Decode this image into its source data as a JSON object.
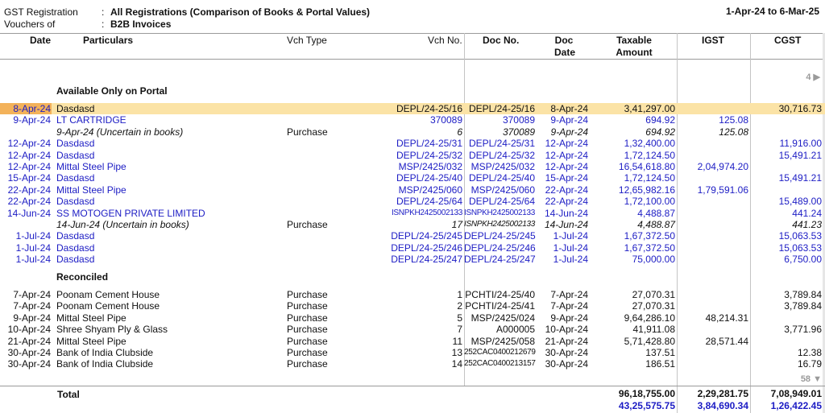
{
  "header": {
    "report_label": "GST Registration",
    "report_value": "All Registrations (Comparison of Books & Portal Values)",
    "vouchers_label": "Vouchers of",
    "vouchers_value": "B2B Invoices",
    "period": "1-Apr-24 to 6-Mar-25"
  },
  "columns": {
    "date": "Date",
    "particulars": "Particulars",
    "vch_type": "Vch Type",
    "vch_no": "Vch No.",
    "doc_no": "Doc No.",
    "doc_date_1": "Doc",
    "doc_date_2": "Date",
    "taxable_1": "Taxable",
    "taxable_2": "Amount",
    "igst": "IGST",
    "cgst": "CGST"
  },
  "scroll_top": "4 ▶",
  "scroll_bottom": "58 ▼",
  "sections": {
    "portal": "Available Only on Portal",
    "reconciled": "Reconciled"
  },
  "portal_rows": [
    {
      "date": "8-Apr-24",
      "particulars": "Dasdasd",
      "vch_type": "",
      "vch_no": "DEPL/24-25/16",
      "doc_no": "DEPL/24-25/16",
      "doc_date": "8-Apr-24",
      "taxable": "3,41,297.00",
      "igst": "",
      "cgst": "30,716.73"
    },
    {
      "date": "9-Apr-24",
      "particulars": "LT CARTRIDGE",
      "vch_type": "",
      "vch_no": "370089",
      "doc_no": "370089",
      "doc_date": "9-Apr-24",
      "taxable": "694.92",
      "igst": "125.08",
      "cgst": ""
    },
    {
      "date": "",
      "particulars": "9-Apr-24 (Uncertain in books)",
      "vch_type": "Purchase",
      "vch_no": "6",
      "doc_no": "370089",
      "doc_date": "9-Apr-24",
      "taxable": "694.92",
      "igst": "125.08",
      "cgst": ""
    },
    {
      "date": "12-Apr-24",
      "particulars": "Dasdasd",
      "vch_type": "",
      "vch_no": "DEPL/24-25/31",
      "doc_no": "DEPL/24-25/31",
      "doc_date": "12-Apr-24",
      "taxable": "1,32,400.00",
      "igst": "",
      "cgst": "11,916.00"
    },
    {
      "date": "12-Apr-24",
      "particulars": "Dasdasd",
      "vch_type": "",
      "vch_no": "DEPL/24-25/32",
      "doc_no": "DEPL/24-25/32",
      "doc_date": "12-Apr-24",
      "taxable": "1,72,124.50",
      "igst": "",
      "cgst": "15,491.21"
    },
    {
      "date": "12-Apr-24",
      "particulars": "Mittal Steel Pipe",
      "vch_type": "",
      "vch_no": "MSP/2425/032",
      "doc_no": "MSP/2425/032",
      "doc_date": "12-Apr-24",
      "taxable": "16,54,618.80",
      "igst": "2,04,974.20",
      "cgst": ""
    },
    {
      "date": "15-Apr-24",
      "particulars": "Dasdasd",
      "vch_type": "",
      "vch_no": "DEPL/24-25/40",
      "doc_no": "DEPL/24-25/40",
      "doc_date": "15-Apr-24",
      "taxable": "1,72,124.50",
      "igst": "",
      "cgst": "15,491.21"
    },
    {
      "date": "22-Apr-24",
      "particulars": "Mittal Steel Pipe",
      "vch_type": "",
      "vch_no": "MSP/2425/060",
      "doc_no": "MSP/2425/060",
      "doc_date": "22-Apr-24",
      "taxable": "12,65,982.16",
      "igst": "1,79,591.06",
      "cgst": ""
    },
    {
      "date": "22-Apr-24",
      "particulars": "Dasdasd",
      "vch_type": "",
      "vch_no": "DEPL/24-25/64",
      "doc_no": "DEPL/24-25/64",
      "doc_date": "22-Apr-24",
      "taxable": "1,72,100.00",
      "igst": "",
      "cgst": "15,489.00"
    },
    {
      "date": "14-Jun-24",
      "particulars": "SS MOTOGEN PRIVATE LIMITED",
      "vch_type": "",
      "vch_no": "ISNPKH2425002133",
      "doc_no": "ISNPKH2425002133",
      "doc_date": "14-Jun-24",
      "taxable": "4,488.87",
      "igst": "",
      "cgst": "441.24"
    },
    {
      "date": "",
      "particulars": "14-Jun-24 (Uncertain in books)",
      "vch_type": "Purchase",
      "vch_no": "17",
      "doc_no": "ISNPKH2425002133",
      "doc_date": "14-Jun-24",
      "taxable": "4,488.87",
      "igst": "",
      "cgst": "441.23"
    },
    {
      "date": "1-Jul-24",
      "particulars": "Dasdasd",
      "vch_type": "",
      "vch_no": "DEPL/24-25/245",
      "doc_no": "DEPL/24-25/245",
      "doc_date": "1-Jul-24",
      "taxable": "1,67,372.50",
      "igst": "",
      "cgst": "15,063.53"
    },
    {
      "date": "1-Jul-24",
      "particulars": "Dasdasd",
      "vch_type": "",
      "vch_no": "DEPL/24-25/246",
      "doc_no": "DEPL/24-25/246",
      "doc_date": "1-Jul-24",
      "taxable": "1,67,372.50",
      "igst": "",
      "cgst": "15,063.53"
    },
    {
      "date": "1-Jul-24",
      "particulars": "Dasdasd",
      "vch_type": "",
      "vch_no": "DEPL/24-25/247",
      "doc_no": "DEPL/24-25/247",
      "doc_date": "1-Jul-24",
      "taxable": "75,000.00",
      "igst": "",
      "cgst": "6,750.00"
    }
  ],
  "reconciled_rows": [
    {
      "date": "7-Apr-24",
      "particulars": "Poonam Cement House",
      "vch_type": "Purchase",
      "vch_no": "1",
      "doc_no": "PCHTI/24-25/40",
      "doc_date": "7-Apr-24",
      "taxable": "27,070.31",
      "igst": "",
      "cgst": "3,789.84"
    },
    {
      "date": "7-Apr-24",
      "particulars": "Poonam Cement House",
      "vch_type": "Purchase",
      "vch_no": "2",
      "doc_no": "PCHTI/24-25/41",
      "doc_date": "7-Apr-24",
      "taxable": "27,070.31",
      "igst": "",
      "cgst": "3,789.84"
    },
    {
      "date": "9-Apr-24",
      "particulars": "Mittal Steel Pipe",
      "vch_type": "Purchase",
      "vch_no": "5",
      "doc_no": "MSP/2425/024",
      "doc_date": "9-Apr-24",
      "taxable": "9,64,286.10",
      "igst": "48,214.31",
      "cgst": ""
    },
    {
      "date": "10-Apr-24",
      "particulars": "Shree Shyam Ply & Glass",
      "vch_type": "Purchase",
      "vch_no": "7",
      "doc_no": "A000005",
      "doc_date": "10-Apr-24",
      "taxable": "41,911.08",
      "igst": "",
      "cgst": "3,771.96"
    },
    {
      "date": "21-Apr-24",
      "particulars": "Mittal Steel Pipe",
      "vch_type": "Purchase",
      "vch_no": "11",
      "doc_no": "MSP/2425/058",
      "doc_date": "21-Apr-24",
      "taxable": "5,71,428.80",
      "igst": "28,571.44",
      "cgst": ""
    },
    {
      "date": "30-Apr-24",
      "particulars": "Bank of India Clubside",
      "vch_type": "Purchase",
      "vch_no": "13",
      "doc_no": "252CAC0400212679",
      "doc_date": "30-Apr-24",
      "taxable": "137.51",
      "igst": "",
      "cgst": "12.38"
    },
    {
      "date": "30-Apr-24",
      "particulars": "Bank of India Clubside",
      "vch_type": "Purchase",
      "vch_no": "14",
      "doc_no": "252CAC0400213157",
      "doc_date": "30-Apr-24",
      "taxable": "186.51",
      "igst": "",
      "cgst": "16.79"
    }
  ],
  "totals": {
    "label": "Total",
    "taxable_books": "96,18,755.00",
    "igst_books": "2,29,281.75",
    "cgst_books": "7,08,949.01",
    "taxable_portal": "43,25,575.75",
    "igst_portal": "3,84,690.34",
    "cgst_portal": "1,26,422.45"
  }
}
